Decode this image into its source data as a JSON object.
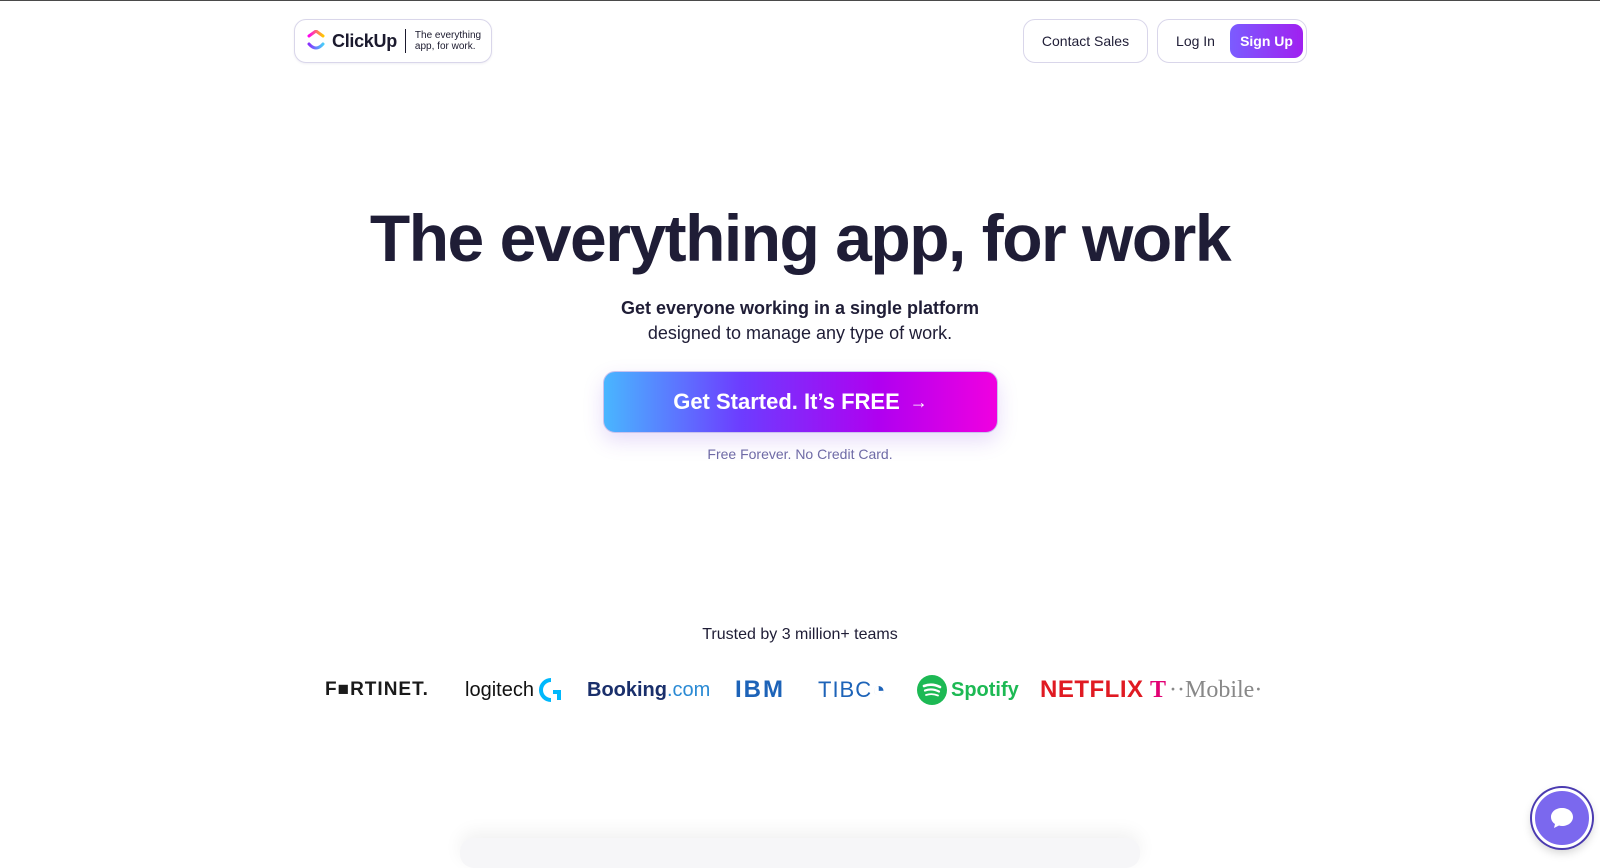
{
  "header": {
    "brand_name": "ClickUp",
    "brand_tagline": "The everything app, for work.",
    "contact_sales_label": "Contact Sales",
    "login_label": "Log In",
    "signup_label": "Sign Up"
  },
  "hero": {
    "title": "The everything app, for work",
    "subtitle_bold": "Get everyone working in a single platform",
    "subtitle_normal": "designed to manage any type of work.",
    "cta_label": "Get Started. It’s FREE",
    "cta_arrow": "→",
    "cta_note": "Free Forever. No Credit Card."
  },
  "trusted": {
    "heading": "Trusted by 3 million+ teams",
    "logos": {
      "fortinet": "F■RTINET.",
      "logitech": "logitech",
      "booking_1": "Booking",
      "booking_2": ".com",
      "ibm": "IBM",
      "tibco": "TIBC◔",
      "spotify": "Spotify",
      "netflix": "NETFLIX",
      "tmobile_t": "T",
      "tmobile_rest": "··Mobile·"
    }
  },
  "colors": {
    "brand_purple": "#7b68ee",
    "cta_start": "#49b6ff",
    "cta_end": "#f000e0",
    "text_dark": "#1f1d36",
    "note_text": "#6e6aa6"
  },
  "icons": {
    "brand": "clickup-logo-icon",
    "chat": "chat-bubble-icon",
    "spotify": "spotify-icon",
    "logitech": "logitech-g-icon"
  }
}
